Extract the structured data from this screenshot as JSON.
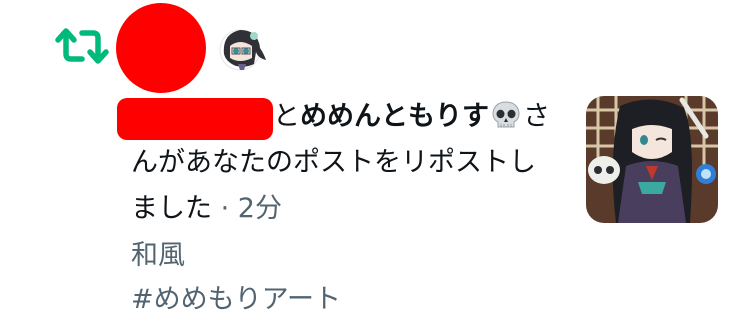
{
  "notification": {
    "icon": "repost-icon",
    "action_color": "#00ba7c",
    "connector": "と",
    "other_user": "めめんともりす",
    "other_user_emoji": "skull-icon",
    "action_suffix_a": "さ",
    "action_line2": "んがあなたのポストをリポストし",
    "action_line3": "ました",
    "separator": "·",
    "time_ago": "2分",
    "post_line1": "和風",
    "post_hashtag": "#めめもりアート"
  }
}
